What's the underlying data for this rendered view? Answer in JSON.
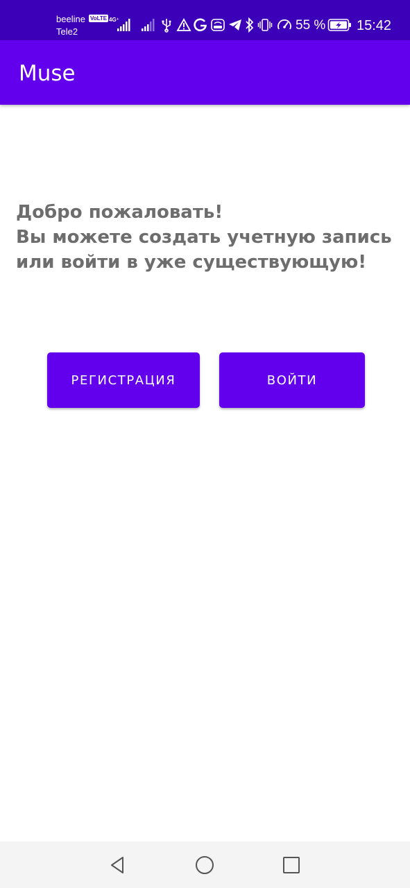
{
  "status_bar": {
    "carrier_1": "beeline",
    "carrier_2": "Tele2",
    "volte": "VoLTE",
    "network": "4G⁺",
    "battery_percent": "55 %",
    "time": "15:42",
    "background_color": "#3c00b8",
    "icons": [
      "signal-icon",
      "signal-weak-icon",
      "usb-icon",
      "warning-icon",
      "google-icon",
      "wifi-hotspot-icon",
      "telegram-icon",
      "bluetooth-icon",
      "vibrate-icon",
      "speedometer-icon",
      "battery-charging-icon"
    ]
  },
  "app_bar": {
    "title": "Muse",
    "color": "#6200ee"
  },
  "main": {
    "welcome_line_1": "Добро пожаловать!",
    "welcome_line_2": "Вы можете создать учетную запись",
    "welcome_line_3": "или войти в уже существующую!",
    "text_color": "#6d6d6d"
  },
  "buttons": {
    "register_label": "РЕГИСТРАЦИЯ",
    "login_label": "ВОЙТИ"
  },
  "nav_bar": {
    "icons": [
      "back-triangle-icon",
      "home-circle-icon",
      "recents-square-icon"
    ]
  }
}
